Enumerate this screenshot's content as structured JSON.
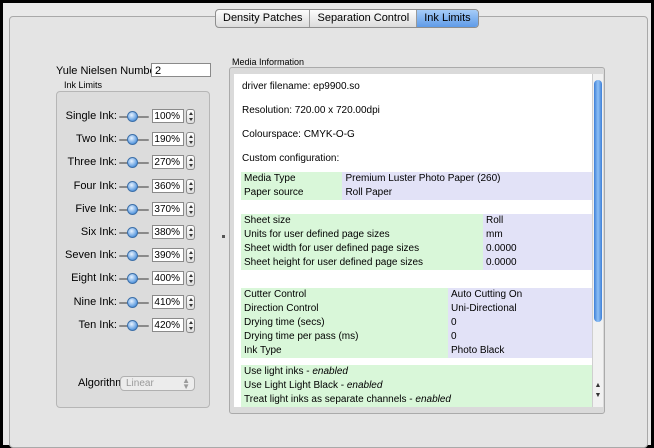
{
  "tabs": [
    "Density Patches",
    "Separation Control",
    "Ink Limits"
  ],
  "active_tab": 2,
  "yule": {
    "label": "Yule Nielsen Number:",
    "value": "2"
  },
  "ink_limits_title": "Ink Limits",
  "inks": [
    {
      "label": "Single Ink:",
      "value": "100%"
    },
    {
      "label": "Two Ink:",
      "value": "190%"
    },
    {
      "label": "Three Ink:",
      "value": "270%"
    },
    {
      "label": "Four Ink:",
      "value": "360%"
    },
    {
      "label": "Five Ink:",
      "value": "370%"
    },
    {
      "label": "Six Ink:",
      "value": "380%"
    },
    {
      "label": "Seven Ink:",
      "value": "390%"
    },
    {
      "label": "Eight Ink:",
      "value": "400%"
    },
    {
      "label": "Nine Ink:",
      "value": "410%"
    },
    {
      "label": "Ten Ink:",
      "value": "420%"
    }
  ],
  "algorithm": {
    "label": "Algorithm",
    "value": "Linear"
  },
  "media": {
    "title": "Media Information",
    "driver": "driver filename: ep9900.so",
    "resolution": "Resolution: 720.00 x 720.00dpi",
    "colourspace": "Colourspace: CMYK-O-G",
    "custom": "Custom configuration:",
    "group1": [
      {
        "k": "Media Type",
        "v": "Premium Luster Photo Paper (260)"
      },
      {
        "k": "Paper source",
        "v": "Roll Paper"
      }
    ],
    "group2": [
      {
        "k": "Sheet size",
        "v": "Roll"
      },
      {
        "k": "Units for user defined page sizes",
        "v": "mm"
      },
      {
        "k": "Sheet width for user defined page sizes",
        "v": "0.0000"
      },
      {
        "k": "Sheet height for user defined page sizes",
        "v": "0.0000"
      }
    ],
    "group3": [
      {
        "k": "Cutter Control",
        "v": "Auto Cutting On"
      },
      {
        "k": "Direction Control",
        "v": "Uni-Directional"
      },
      {
        "k": "Drying time (secs)",
        "v": "0"
      },
      {
        "k": "Drying time per pass (ms)",
        "v": "0"
      },
      {
        "k": "Ink Type",
        "v": "Photo Black"
      }
    ],
    "flags": [
      {
        "text": "Use light inks",
        "state": "enabled"
      },
      {
        "text": "Use Light Light Black",
        "state": "enabled"
      },
      {
        "text": "Treat light inks as separate channels",
        "state": "enabled"
      }
    ],
    "flag_sep": " - "
  },
  "colors": {
    "key_bg": "#d9f7d9",
    "value_bg": "#e2e2f7",
    "tab_active": "#5f9be8"
  }
}
